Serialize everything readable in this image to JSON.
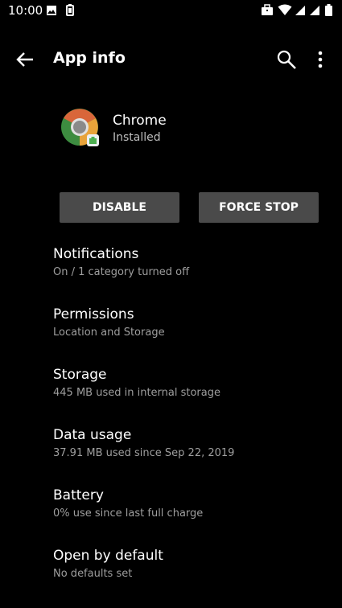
{
  "status_bar": {
    "time": "10:00",
    "left_icons": [
      "image-icon",
      "battery-saver-icon"
    ],
    "right_icons": [
      "briefcase-icon",
      "wifi-icon",
      "signal-icon",
      "signal-icon",
      "battery-icon"
    ]
  },
  "app_bar": {
    "title": "App info",
    "icons": [
      "back-arrow-icon",
      "search-icon",
      "more-vert-icon"
    ]
  },
  "app": {
    "name": "Chrome",
    "status": "Installed",
    "icon": "chrome-icon"
  },
  "buttons": {
    "disable": "DISABLE",
    "force_stop": "FORCE STOP"
  },
  "items": [
    {
      "title": "Notifications",
      "subtitle": "On / 1 category turned off"
    },
    {
      "title": "Permissions",
      "subtitle": "Location and Storage"
    },
    {
      "title": "Storage",
      "subtitle": "445 MB used in internal storage"
    },
    {
      "title": "Data usage",
      "subtitle": "37.91 MB used since Sep 22, 2019"
    },
    {
      "title": "Battery",
      "subtitle": "0% use since last full charge"
    },
    {
      "title": "Open by default",
      "subtitle": "No defaults set"
    }
  ],
  "colors": {
    "background": "#000000",
    "button": "#4a4a4a",
    "subtitle": "#9e9e9e"
  }
}
